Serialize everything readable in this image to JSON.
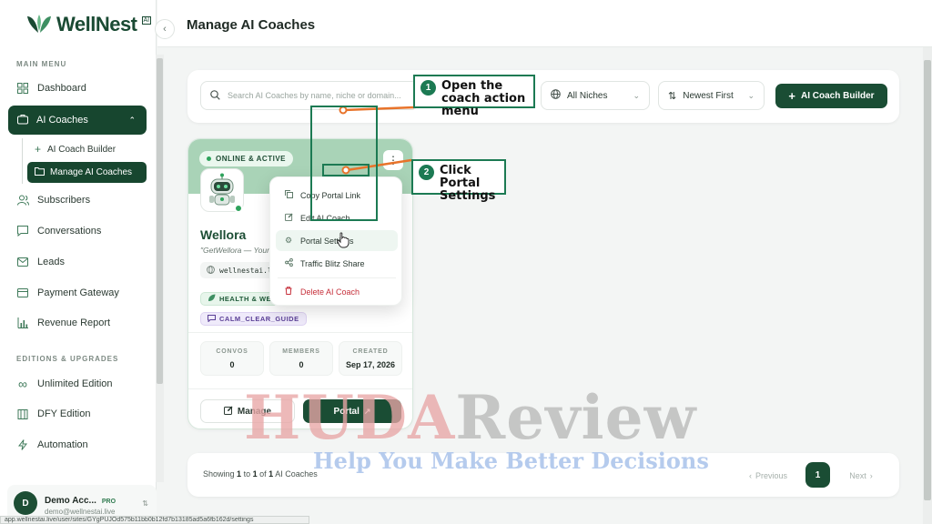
{
  "brand": {
    "name": "WellNest",
    "badge": "AI"
  },
  "sidebar": {
    "main_menu_label": "MAIN MENU",
    "items": [
      {
        "label": "Dashboard",
        "icon": "grid-icon"
      },
      {
        "label": "AI Coaches",
        "icon": "briefcase-icon"
      },
      {
        "label": "AI Coach Builder",
        "icon": "plus-icon"
      },
      {
        "label": "Manage AI Coaches",
        "icon": "folder-icon"
      },
      {
        "label": "Subscribers",
        "icon": "users-icon"
      },
      {
        "label": "Conversations",
        "icon": "chat-icon"
      },
      {
        "label": "Leads",
        "icon": "mail-icon"
      },
      {
        "label": "Payment Gateway",
        "icon": "card-icon"
      },
      {
        "label": "Revenue Report",
        "icon": "bar-chart-icon"
      }
    ],
    "editions_label": "EDITIONS & UPGRADES",
    "edition_items": [
      {
        "label": "Unlimited Edition",
        "icon": "infinity-icon"
      },
      {
        "label": "DFY Edition",
        "icon": "building-icon"
      },
      {
        "label": "Automation",
        "icon": "lightning-icon"
      }
    ],
    "account": {
      "initial": "D",
      "name": "Demo Acc...",
      "badge": "PRO",
      "email": "demo@wellnestai.live"
    }
  },
  "header": {
    "title": "Manage AI Coaches"
  },
  "toolbar": {
    "search_placeholder": "Search AI Coaches by name, niche or domain...",
    "niche_value": "All Niches",
    "sort_value": "Newest First",
    "builder_button": "AI Coach Builder"
  },
  "coach": {
    "status": "ONLINE & ACTIVE",
    "name": "Wellora",
    "tagline": "\"GetWellora — Your",
    "url": "wellnestai.li",
    "tag1": "HEALTH & WE",
    "tag2": "CALM_CLEAR_GUIDE",
    "stats": [
      {
        "label": "CONVOS",
        "value": "0"
      },
      {
        "label": "MEMBERS",
        "value": "0"
      },
      {
        "label": "CREATED",
        "value": "Sep 17, 2026"
      }
    ],
    "manage_button": "Manage",
    "portal_button": "Portal"
  },
  "menu": {
    "items": [
      {
        "label": "Copy Portal Link",
        "icon": "copy-icon"
      },
      {
        "label": "Edit AI Coach",
        "icon": "edit-icon"
      },
      {
        "label": "Portal Settings",
        "icon": "gear-icon"
      },
      {
        "label": "Traffic Blitz Share",
        "icon": "share-icon"
      },
      {
        "label": "Delete AI Coach",
        "icon": "trash-icon"
      }
    ]
  },
  "pagination": {
    "showing": "Showing",
    "from": "1",
    "to_word": "to",
    "to": "1",
    "of_word": "of",
    "total": "1",
    "suffix": "AI Coaches",
    "prev": "Previous",
    "page": "1",
    "next": "Next"
  },
  "annotations": {
    "step1_num": "1",
    "step1_text": "Open the coach action menu",
    "step2_num": "2",
    "step2_text": "Click Portal Settings"
  },
  "watermark": {
    "main_a": "HUDA",
    "main_b": "Review",
    "sub": "Help You Make Better Decisions"
  },
  "status_url": "app.wellnestai.live/user/sites/GYgPUJOd575b11bb0b12fd7b13185ad5a6fb162d/settings",
  "colors": {
    "brand_dark": "#1a4d34",
    "accent_green": "#2ea35c",
    "annotation": "#1c7a53",
    "danger": "#c62f3a"
  }
}
